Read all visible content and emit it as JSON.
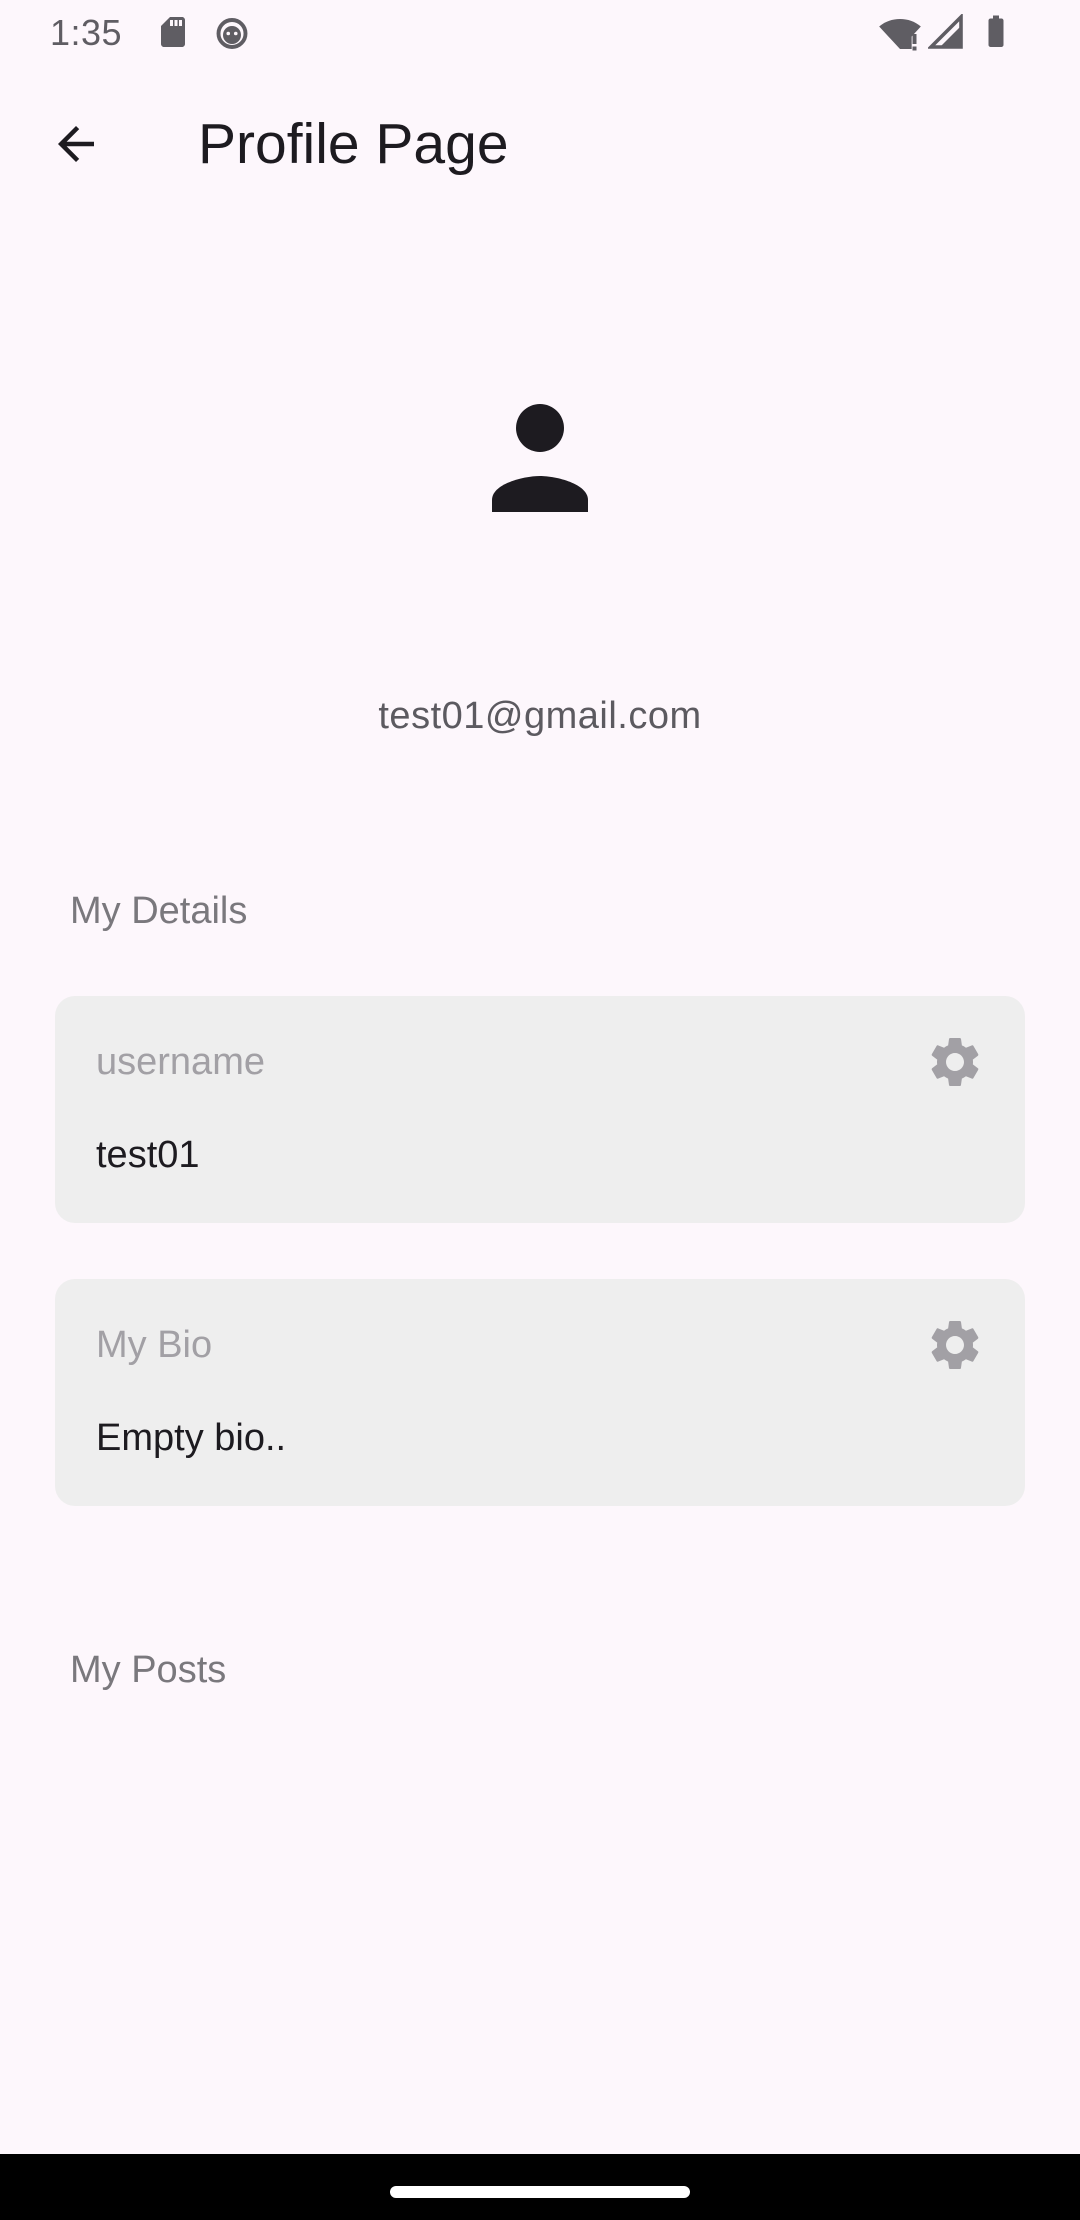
{
  "status_bar": {
    "time": "1:35",
    "left_icons": [
      "sd-card-icon",
      "android-debug-icon"
    ],
    "right_icons": [
      "wifi-alert-icon",
      "signal-icon",
      "battery-icon"
    ]
  },
  "app_bar": {
    "back_icon": "arrow-back-icon",
    "title": "Profile Page"
  },
  "profile": {
    "avatar_icon": "person-icon",
    "email": "test01@gmail.com"
  },
  "details_section": {
    "label": "My Details",
    "cards": [
      {
        "label": "username",
        "value": "test01",
        "action_icon": "gear-icon"
      },
      {
        "label": "My Bio",
        "value": "Empty bio..",
        "action_icon": "gear-icon"
      }
    ]
  },
  "posts_section": {
    "label": "My Posts"
  },
  "colors": {
    "background": "#fdf7fc",
    "card": "#eeeeee",
    "text_primary": "#1d1b20",
    "text_muted": "#a2a0a5"
  }
}
